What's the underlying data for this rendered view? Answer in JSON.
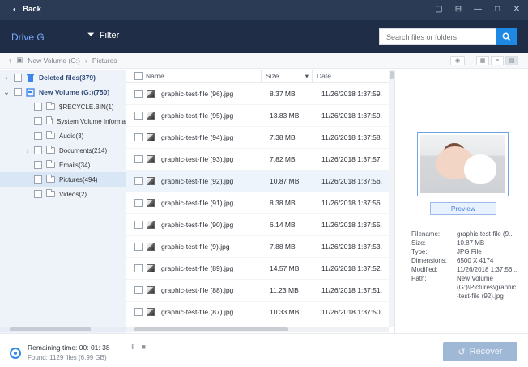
{
  "topbar": {
    "back_label": "Back"
  },
  "toolbar": {
    "drive_label": "Drive G",
    "filter_label": "Filter",
    "search_placeholder": "Search files or folders"
  },
  "breadcrumb": {
    "items": [
      "New Volume (G:)",
      "Pictures"
    ]
  },
  "tree": {
    "items": [
      {
        "label": "Deleted files(379)"
      },
      {
        "label": "New Volume (G:)(750)"
      },
      {
        "label": "$RECYCLE.BIN(1)"
      },
      {
        "label": "System Volume Informa"
      },
      {
        "label": "Audio(3)"
      },
      {
        "label": "Documents(214)"
      },
      {
        "label": "Emails(34)"
      },
      {
        "label": "Pictures(494)"
      },
      {
        "label": "Videos(2)"
      }
    ]
  },
  "table": {
    "columns": {
      "name": "Name",
      "size": "Size",
      "date": "Date"
    },
    "rows": [
      {
        "name": "graphic-test-file (96).jpg",
        "size": "8.37 MB",
        "date": "11/26/2018 1:37:59."
      },
      {
        "name": "graphic-test-file (95).jpg",
        "size": "13.83 MB",
        "date": "11/26/2018 1:37:59."
      },
      {
        "name": "graphic-test-file (94).jpg",
        "size": "7.38 MB",
        "date": "11/26/2018 1:37:58."
      },
      {
        "name": "graphic-test-file (93).jpg",
        "size": "7.82 MB",
        "date": "11/26/2018 1:37:57."
      },
      {
        "name": "graphic-test-file (92).jpg",
        "size": "10.87 MB",
        "date": "11/26/2018 1:37:56."
      },
      {
        "name": "graphic-test-file (91).jpg",
        "size": "8.38 MB",
        "date": "11/26/2018 1:37:56."
      },
      {
        "name": "graphic-test-file (90).jpg",
        "size": "6.14 MB",
        "date": "11/26/2018 1:37:55."
      },
      {
        "name": "graphic-test-file (9).jpg",
        "size": "7.88 MB",
        "date": "11/26/2018 1:37:53."
      },
      {
        "name": "graphic-test-file (89).jpg",
        "size": "14.57 MB",
        "date": "11/26/2018 1:37:52."
      },
      {
        "name": "graphic-test-file (88).jpg",
        "size": "11.23 MB",
        "date": "11/26/2018 1:37:51."
      },
      {
        "name": "graphic-test-file (87).jpg",
        "size": "10.33 MB",
        "date": "11/26/2018 1:37:50."
      }
    ]
  },
  "preview": {
    "button_label": "Preview",
    "details": {
      "filename_label": "Filename:",
      "filename": "graphic-test-file (9...",
      "size_label": "Size:",
      "size": "10.87 MB",
      "type_label": "Type:",
      "type": "JPG File",
      "dimensions_label": "Dimensions:",
      "dimensions": "6500 X 4174",
      "modified_label": "Modified:",
      "modified": "11/26/2018 1:37:56...",
      "path_label": "Path:",
      "path": "New Volume\n(G:)\\Pictures\\graphic\n-test-file (92).jpg"
    }
  },
  "footer": {
    "remaining": "Remaining time: 00: 01: 38",
    "found": "Found: 1129 files (6.99 GB)",
    "recover_label": "Recover"
  }
}
